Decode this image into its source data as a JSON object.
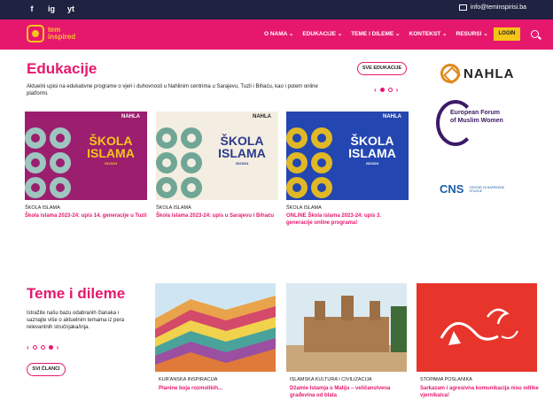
{
  "topbar": {
    "social": [
      "f",
      "ig",
      "yt"
    ],
    "email": "info@teminspirisi.ba"
  },
  "nav": {
    "logo_line1": "tem",
    "logo_line2": "inspired",
    "items": [
      "O NAMA ⌄",
      "EDUKACIJE ⌄",
      "TEME I DILEME ⌄",
      "KONTEKST ⌄",
      "RESURSI ⌄"
    ],
    "login": "LOGIN"
  },
  "edukacije": {
    "title": "Edukacije",
    "intro": "Aktuelni upisi na edukativne programe o vjeri i duhovnosti u Nahlinim centrima u Sarajevu, Tuzli i Bihaću, kao i putem online platformi.",
    "all_button": "SVE EDUKACIJE",
    "pager_prev": "‹",
    "pager_next": "›",
    "cards": [
      {
        "badge": "NAHLA",
        "line1": "ŠKOLA",
        "line2": "ISLAMA",
        "line3": "2023/24",
        "category": "ŠKOLA ISLAMA",
        "title": "Škola islama 2023-24: upis 14. generacije u Tuzli",
        "bg": "#9b1f6e"
      },
      {
        "badge": "NAHLA",
        "line1": "ŠKOLA",
        "line2": "ISLAMA",
        "line3": "2023/24",
        "category": "ŠKOLA ISLAMA",
        "title": "Škola islama 2023-24: upis u Sarajevu i Bihaću",
        "bg": "#f3eee1"
      },
      {
        "badge": "NAHLA",
        "line1": "ŠKOLA",
        "line2": "ISLAMA",
        "line3": "2023/24",
        "category": "ŠKOLA ISLAMA",
        "title": "ONLINE Škola islama 2023-24: upis 3. generacije online programa!",
        "bg": "#2446b0"
      }
    ]
  },
  "partners": {
    "nahla": "NAHLA",
    "efomw": [
      "European Forum",
      "of Muslim Women"
    ],
    "cns": "CNS",
    "cns_sub": "CENTAR ZA NAPREDNE STUDIJE"
  },
  "teme": {
    "title": "Teme i dileme",
    "intro": "Istražite našu bazu odabranih članaka i saznajte više o aktuelnim temama iz pera relevantnih stručnjaka/inja.",
    "all_button": "SVI ČLANCI",
    "pager_prev": "‹",
    "pager_next": "›",
    "cards": [
      {
        "category": "KUR'ANSKA INSPIRACIJA",
        "title": "Planine boja rozmolikih..."
      },
      {
        "category": "ISLAMSKA KULTURA I CIVILIZACIJA",
        "title": "Džamie Istamja u Maliju – veličanstvena građevina od blata"
      },
      {
        "category": "STOPAMA POSLANIKA",
        "title": "Sarkazam i agresivna komunikacija nisu odlike vjernika/ca!"
      }
    ]
  },
  "colors": {
    "brand": "#e6186e",
    "topbar": "#1f2240",
    "accent": "#f5c518"
  }
}
